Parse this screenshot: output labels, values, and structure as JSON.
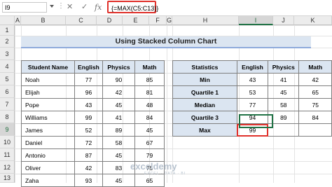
{
  "name_box": "I9",
  "formula": "{=MAX(C5:C13)}",
  "formula_icons": {
    "cancel": "✕",
    "enter": "✓",
    "fx": "fx"
  },
  "columns": [
    "A",
    "B",
    "C",
    "D",
    "E",
    "F",
    "G",
    "H",
    "I",
    "J",
    "K"
  ],
  "selected_column": "I",
  "rows": [
    "1",
    "2",
    "3",
    "4",
    "5",
    "6",
    "7",
    "8",
    "9",
    "10",
    "11",
    "12",
    "13"
  ],
  "selected_row": "9",
  "title": "Using Stacked Column Chart",
  "main_table": {
    "headers": [
      "Student Name",
      "English",
      "Physics",
      "Math"
    ],
    "rows": [
      [
        "Noah",
        "77",
        "90",
        "85"
      ],
      [
        "Elijah",
        "96",
        "42",
        "81"
      ],
      [
        "Pope",
        "43",
        "45",
        "48"
      ],
      [
        "Williams",
        "99",
        "41",
        "84"
      ],
      [
        "James",
        "52",
        "89",
        "45"
      ],
      [
        "Daniel",
        "72",
        "58",
        "67"
      ],
      [
        "Antonio",
        "87",
        "45",
        "79"
      ],
      [
        "Oliver",
        "42",
        "83",
        "75"
      ],
      [
        "Zaha",
        "93",
        "45",
        "65"
      ]
    ]
  },
  "stats_table": {
    "headers": [
      "Statistics",
      "English",
      "Physics",
      "Math"
    ],
    "rows": [
      [
        "Min",
        "43",
        "41",
        "42"
      ],
      [
        "Quartile 1",
        "53",
        "45",
        "65"
      ],
      [
        "Median",
        "77",
        "58",
        "75"
      ],
      [
        "Quartile 3",
        "94",
        "89",
        "84"
      ],
      [
        "Max",
        "99",
        "",
        ""
      ]
    ]
  },
  "watermark": {
    "brand": "exceldemy",
    "tagline": "EXCEL · DATA · BI"
  },
  "colors": {
    "header_fill": "#dbe5f1",
    "highlight": "#e0312b",
    "excel_green": "#217346"
  }
}
